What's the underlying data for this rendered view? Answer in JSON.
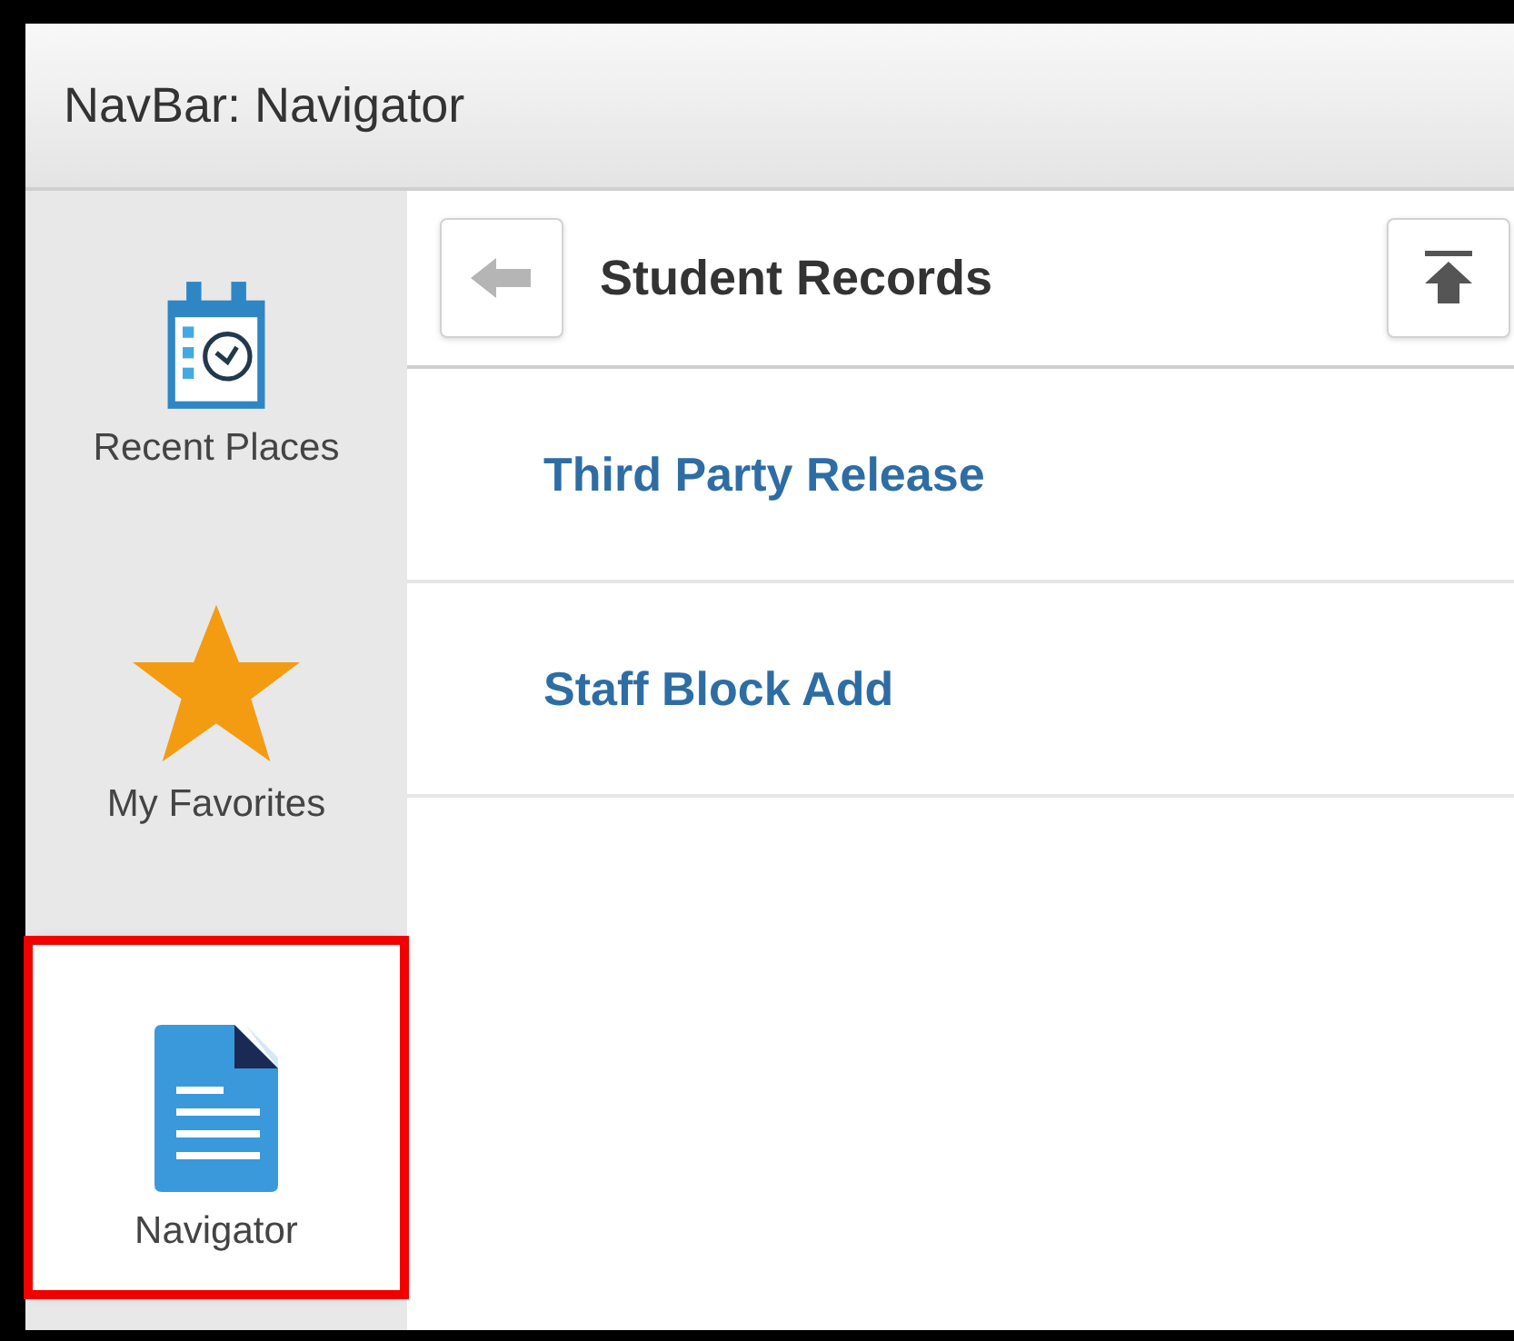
{
  "window": {
    "title": "NavBar: Navigator"
  },
  "sidebar": {
    "items": [
      {
        "kind": "calendar",
        "label": "Recent Places",
        "selected": false,
        "highlighted": false
      },
      {
        "kind": "star",
        "label": "My Favorites",
        "selected": false,
        "highlighted": false
      },
      {
        "kind": "document",
        "label": "Navigator",
        "selected": true,
        "highlighted": true
      }
    ]
  },
  "panel": {
    "title": "Student Records",
    "items": [
      {
        "label": "Third Party Release"
      },
      {
        "label": "Staff Block Add"
      }
    ]
  }
}
